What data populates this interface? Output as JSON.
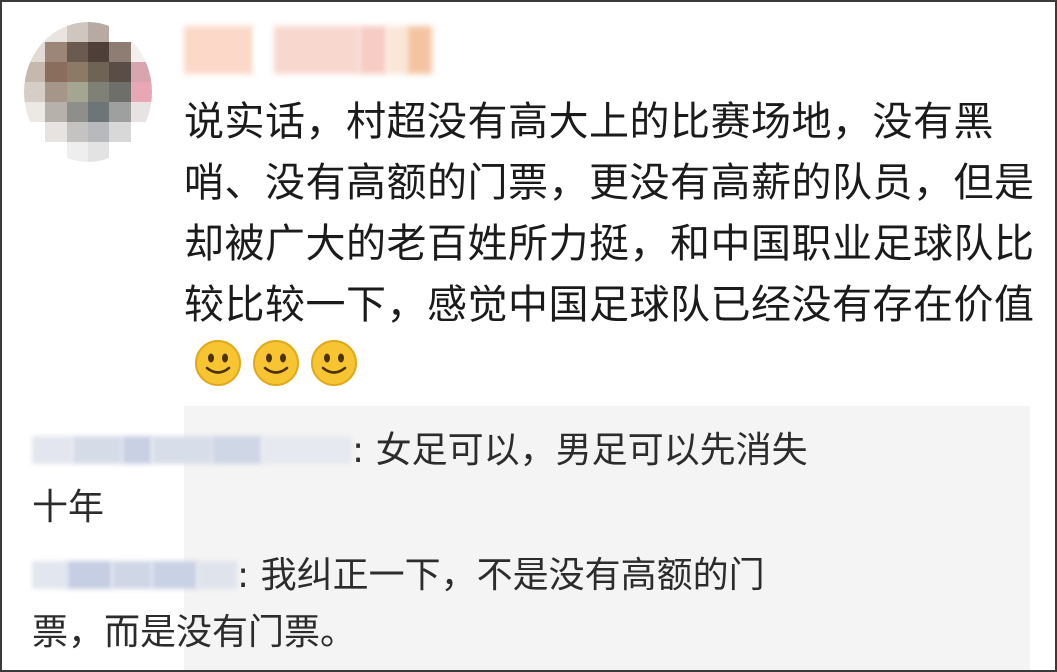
{
  "comment": {
    "text": "说实话，村超没有高大上的比赛场地，没有黑哨、没有高额的门票，更没有高薪的队员，但是却被广大的老百姓所力挺，和中国职业足球队比较比较一下，感觉中国足球队已经没有存在价值",
    "emoji": [
      "smiley-emoji",
      "smiley-emoji",
      "smiley-emoji"
    ]
  },
  "replies": [
    {
      "text": ": 女足可以，男足可以先消失十年"
    },
    {
      "text": ": 我纠正一下，不是没有高额的门票，而是没有门票。"
    }
  ],
  "colors": {
    "background": "#ffffff",
    "reply_background": "#f4f4f4",
    "text": "#1b1b1b",
    "emoji_face": "#f7c531"
  }
}
